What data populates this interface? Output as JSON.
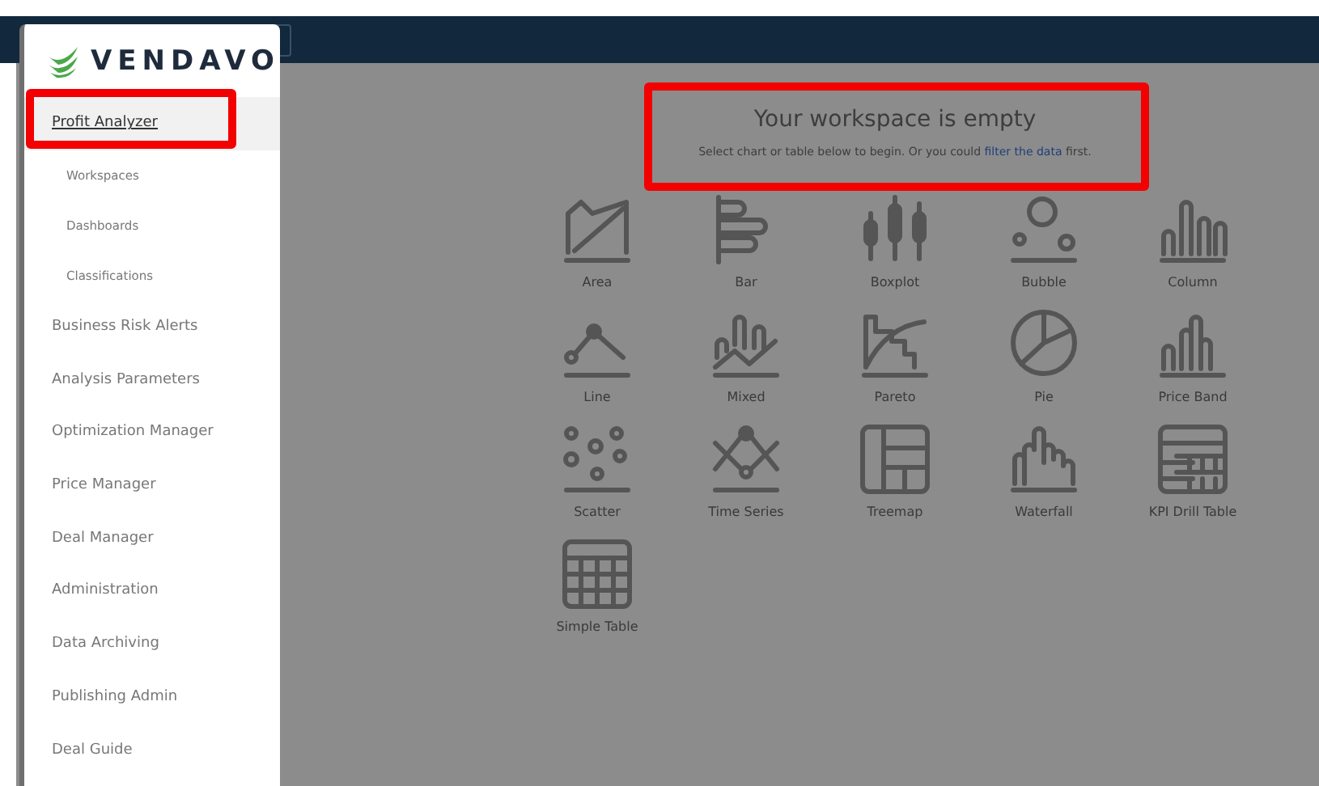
{
  "logo": {
    "text": "VENDAVO"
  },
  "nav": [
    {
      "label": "Profit Analyzer",
      "selected": true,
      "children": [
        {
          "label": "Workspaces",
          "selected": false
        },
        {
          "label": "Dashboards",
          "selected": false
        },
        {
          "label": "Classifications",
          "selected": false
        }
      ]
    },
    {
      "label": "Business Risk Alerts",
      "selected": false
    },
    {
      "label": "Analysis Parameters",
      "selected": false
    },
    {
      "label": "Optimization Manager",
      "selected": false
    },
    {
      "label": "Price Manager",
      "selected": false
    },
    {
      "label": "Deal Manager",
      "selected": false
    },
    {
      "label": "Administration",
      "selected": false
    },
    {
      "label": "Data Archiving",
      "selected": false
    },
    {
      "label": "Publishing Admin",
      "selected": false
    },
    {
      "label": "Deal Guide",
      "selected": false
    }
  ],
  "workspace": {
    "title": "Your workspace is empty",
    "message": "Select chart or table below to begin. Or you could ",
    "link": "filter the data",
    "message_end": " first."
  },
  "chart_types": [
    {
      "label": "Area"
    },
    {
      "label": "Bar"
    },
    {
      "label": "Boxplot"
    },
    {
      "label": "Bubble"
    },
    {
      "label": "Column"
    },
    {
      "label": "Line"
    },
    {
      "label": "Mixed"
    },
    {
      "label": "Pareto"
    },
    {
      "label": "Pie"
    },
    {
      "label": "Price Band"
    },
    {
      "label": "Scatter"
    },
    {
      "label": "Time Series"
    },
    {
      "label": "Treemap"
    },
    {
      "label": "Waterfall"
    },
    {
      "label": "KPI Drill Table"
    },
    {
      "label": "Simple Table"
    }
  ]
}
